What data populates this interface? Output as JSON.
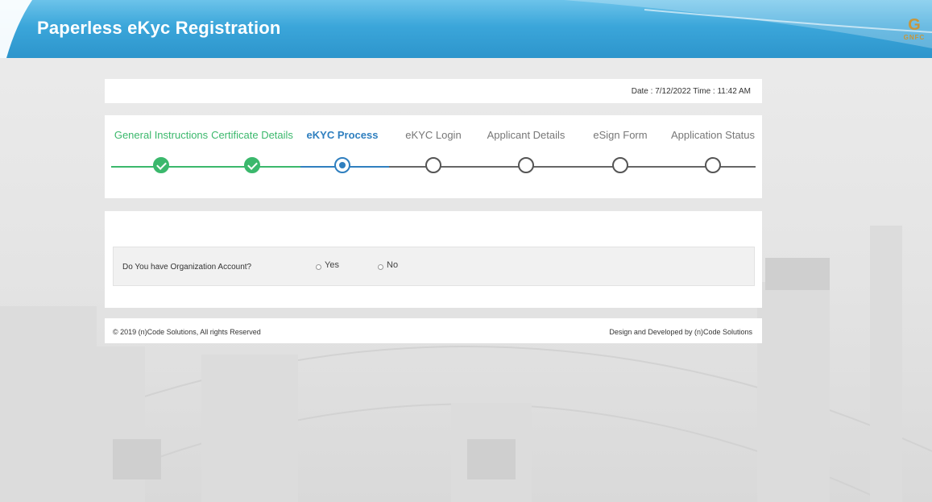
{
  "header": {
    "title": "Paperless eKyc Registration",
    "logo_glyph": "G",
    "logo_text": "GNFC",
    "colors": {
      "primary": "#2d95cc",
      "light": "#6cc3ea"
    }
  },
  "date_bar": {
    "text": "Date : 7/12/2022 Time : 11:42 AM"
  },
  "stepper": {
    "steps": [
      {
        "label": "General Instructions",
        "state": "done"
      },
      {
        "label": "Certificate Details",
        "state": "done"
      },
      {
        "label": "eKYC Process",
        "state": "active"
      },
      {
        "label": "eKYC Login",
        "state": "pending"
      },
      {
        "label": "Applicant Details",
        "state": "pending"
      },
      {
        "label": "eSign Form",
        "state": "pending"
      },
      {
        "label": "Application Status",
        "state": "pending"
      }
    ],
    "colors": {
      "done": "#3bb86c",
      "active": "#2f7fbf",
      "pending": "#555555"
    }
  },
  "form": {
    "question": "Do You have Organization Account?",
    "options": [
      {
        "label": "Yes",
        "checked": false
      },
      {
        "label": "No",
        "checked": false
      }
    ]
  },
  "footer": {
    "left": "© 2019 (n)Code Solutions, All rights Reserved",
    "right": "Design and Developed by (n)Code Solutions"
  }
}
